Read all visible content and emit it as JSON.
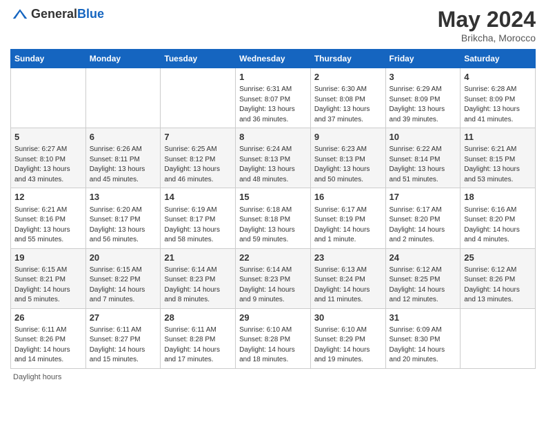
{
  "header": {
    "logo_general": "General",
    "logo_blue": "Blue",
    "month_year": "May 2024",
    "location": "Brikcha, Morocco"
  },
  "days_of_week": [
    "Sunday",
    "Monday",
    "Tuesday",
    "Wednesday",
    "Thursday",
    "Friday",
    "Saturday"
  ],
  "weeks": [
    {
      "cells": [
        {
          "day": null,
          "info": null
        },
        {
          "day": null,
          "info": null
        },
        {
          "day": null,
          "info": null
        },
        {
          "day": "1",
          "info": "Sunrise: 6:31 AM\nSunset: 8:07 PM\nDaylight: 13 hours\nand 36 minutes."
        },
        {
          "day": "2",
          "info": "Sunrise: 6:30 AM\nSunset: 8:08 PM\nDaylight: 13 hours\nand 37 minutes."
        },
        {
          "day": "3",
          "info": "Sunrise: 6:29 AM\nSunset: 8:09 PM\nDaylight: 13 hours\nand 39 minutes."
        },
        {
          "day": "4",
          "info": "Sunrise: 6:28 AM\nSunset: 8:09 PM\nDaylight: 13 hours\nand 41 minutes."
        }
      ]
    },
    {
      "cells": [
        {
          "day": "5",
          "info": "Sunrise: 6:27 AM\nSunset: 8:10 PM\nDaylight: 13 hours\nand 43 minutes."
        },
        {
          "day": "6",
          "info": "Sunrise: 6:26 AM\nSunset: 8:11 PM\nDaylight: 13 hours\nand 45 minutes."
        },
        {
          "day": "7",
          "info": "Sunrise: 6:25 AM\nSunset: 8:12 PM\nDaylight: 13 hours\nand 46 minutes."
        },
        {
          "day": "8",
          "info": "Sunrise: 6:24 AM\nSunset: 8:13 PM\nDaylight: 13 hours\nand 48 minutes."
        },
        {
          "day": "9",
          "info": "Sunrise: 6:23 AM\nSunset: 8:13 PM\nDaylight: 13 hours\nand 50 minutes."
        },
        {
          "day": "10",
          "info": "Sunrise: 6:22 AM\nSunset: 8:14 PM\nDaylight: 13 hours\nand 51 minutes."
        },
        {
          "day": "11",
          "info": "Sunrise: 6:21 AM\nSunset: 8:15 PM\nDaylight: 13 hours\nand 53 minutes."
        }
      ]
    },
    {
      "cells": [
        {
          "day": "12",
          "info": "Sunrise: 6:21 AM\nSunset: 8:16 PM\nDaylight: 13 hours\nand 55 minutes."
        },
        {
          "day": "13",
          "info": "Sunrise: 6:20 AM\nSunset: 8:17 PM\nDaylight: 13 hours\nand 56 minutes."
        },
        {
          "day": "14",
          "info": "Sunrise: 6:19 AM\nSunset: 8:17 PM\nDaylight: 13 hours\nand 58 minutes."
        },
        {
          "day": "15",
          "info": "Sunrise: 6:18 AM\nSunset: 8:18 PM\nDaylight: 13 hours\nand 59 minutes."
        },
        {
          "day": "16",
          "info": "Sunrise: 6:17 AM\nSunset: 8:19 PM\nDaylight: 14 hours\nand 1 minute."
        },
        {
          "day": "17",
          "info": "Sunrise: 6:17 AM\nSunset: 8:20 PM\nDaylight: 14 hours\nand 2 minutes."
        },
        {
          "day": "18",
          "info": "Sunrise: 6:16 AM\nSunset: 8:20 PM\nDaylight: 14 hours\nand 4 minutes."
        }
      ]
    },
    {
      "cells": [
        {
          "day": "19",
          "info": "Sunrise: 6:15 AM\nSunset: 8:21 PM\nDaylight: 14 hours\nand 5 minutes."
        },
        {
          "day": "20",
          "info": "Sunrise: 6:15 AM\nSunset: 8:22 PM\nDaylight: 14 hours\nand 7 minutes."
        },
        {
          "day": "21",
          "info": "Sunrise: 6:14 AM\nSunset: 8:23 PM\nDaylight: 14 hours\nand 8 minutes."
        },
        {
          "day": "22",
          "info": "Sunrise: 6:14 AM\nSunset: 8:23 PM\nDaylight: 14 hours\nand 9 minutes."
        },
        {
          "day": "23",
          "info": "Sunrise: 6:13 AM\nSunset: 8:24 PM\nDaylight: 14 hours\nand 11 minutes."
        },
        {
          "day": "24",
          "info": "Sunrise: 6:12 AM\nSunset: 8:25 PM\nDaylight: 14 hours\nand 12 minutes."
        },
        {
          "day": "25",
          "info": "Sunrise: 6:12 AM\nSunset: 8:26 PM\nDaylight: 14 hours\nand 13 minutes."
        }
      ]
    },
    {
      "cells": [
        {
          "day": "26",
          "info": "Sunrise: 6:11 AM\nSunset: 8:26 PM\nDaylight: 14 hours\nand 14 minutes."
        },
        {
          "day": "27",
          "info": "Sunrise: 6:11 AM\nSunset: 8:27 PM\nDaylight: 14 hours\nand 15 minutes."
        },
        {
          "day": "28",
          "info": "Sunrise: 6:11 AM\nSunset: 8:28 PM\nDaylight: 14 hours\nand 17 minutes."
        },
        {
          "day": "29",
          "info": "Sunrise: 6:10 AM\nSunset: 8:28 PM\nDaylight: 14 hours\nand 18 minutes."
        },
        {
          "day": "30",
          "info": "Sunrise: 6:10 AM\nSunset: 8:29 PM\nDaylight: 14 hours\nand 19 minutes."
        },
        {
          "day": "31",
          "info": "Sunrise: 6:09 AM\nSunset: 8:30 PM\nDaylight: 14 hours\nand 20 minutes."
        },
        {
          "day": null,
          "info": null
        }
      ]
    }
  ],
  "footer": {
    "note": "Daylight hours"
  }
}
